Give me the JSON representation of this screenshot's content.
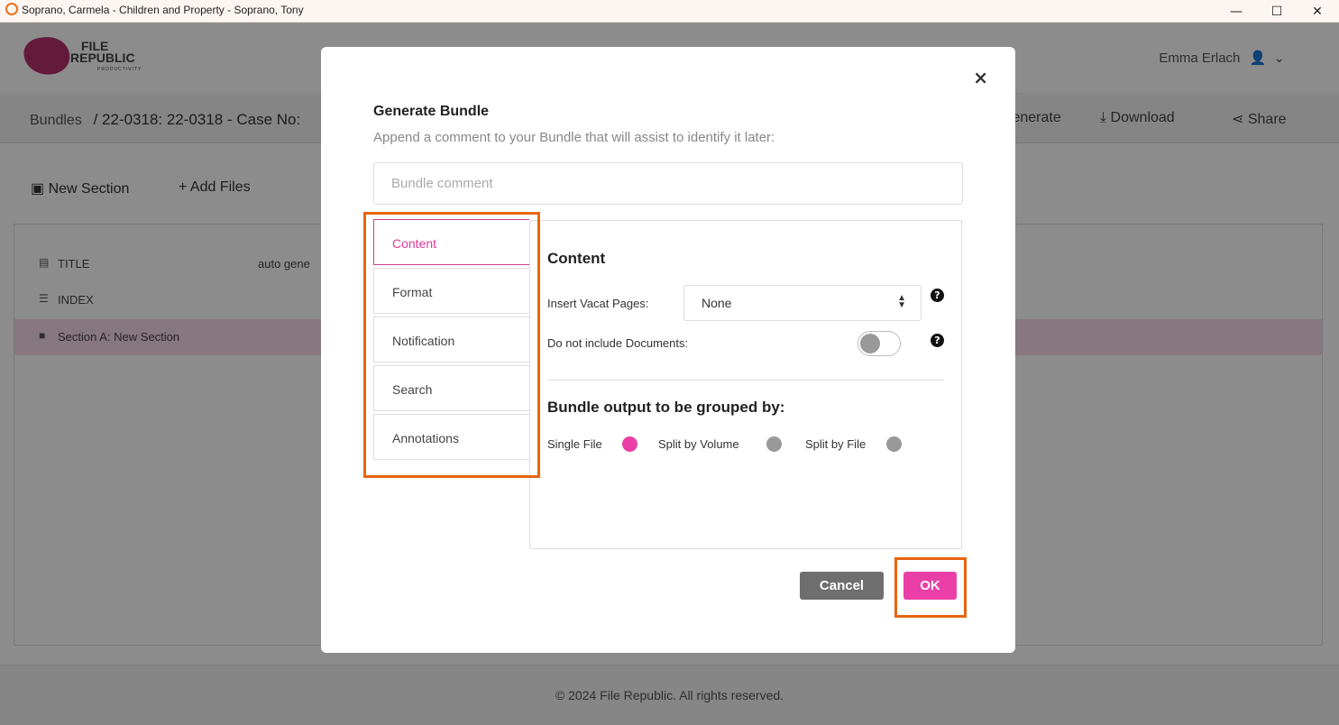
{
  "window": {
    "title": "Soprano, Carmela - Children and Property - Soprano, Tony",
    "minimize_glyph": "—",
    "maximize_glyph": "☐",
    "close_glyph": "✕"
  },
  "header": {
    "logo_line1": "FILE",
    "logo_line2": "REPUBLIC",
    "logo_sub": "PRODUCTIVITY",
    "user_name": "Emma Erlach"
  },
  "breadcrumb": {
    "root": "Bundles",
    "path": "/ 22-0318: 22-0318 - Case No:"
  },
  "header_actions": {
    "generate": "Generate",
    "download": "Download",
    "share": "Share"
  },
  "toolbar": {
    "new_section": "New Section",
    "add_files": "Add Files"
  },
  "tree": {
    "title_label": "TITLE",
    "title_value": "auto gene",
    "index_label": "INDEX",
    "section_label": "Section A: New Section"
  },
  "footer": {
    "copyright": "© 2024 File Republic. All rights reserved."
  },
  "modal": {
    "close_glyph": "×",
    "title": "Generate Bundle",
    "subtitle": "Append a comment to your Bundle that will assist to identify it later:",
    "comment_placeholder": "Bundle comment",
    "tabs": [
      {
        "label": "Content",
        "active": true
      },
      {
        "label": "Format",
        "active": false
      },
      {
        "label": "Notification",
        "active": false
      },
      {
        "label": "Search",
        "active": false
      },
      {
        "label": "Annotations",
        "active": false
      }
    ],
    "panel": {
      "heading": "Content",
      "vacat_label": "Insert Vacat Pages:",
      "vacat_value": "None",
      "no_docs_label": "Do not include Documents:",
      "no_docs_enabled": false,
      "group_heading": "Bundle output to be grouped by:",
      "group_options": [
        {
          "label": "Single File",
          "selected": true
        },
        {
          "label": "Split by Volume",
          "selected": false
        },
        {
          "label": "Split by File",
          "selected": false
        }
      ]
    },
    "cancel_label": "Cancel",
    "ok_label": "OK"
  },
  "colors": {
    "accent": "#ea3fa6",
    "highlight": "#e8650f",
    "cancel": "#6e6e6e"
  }
}
